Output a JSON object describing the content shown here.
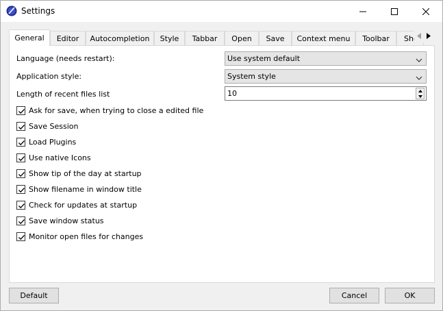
{
  "window": {
    "title": "Settings",
    "app_icon": "app-orb-icon",
    "controls": [
      "minimize-icon",
      "maximize-icon",
      "close-icon"
    ]
  },
  "tabs": [
    {
      "label": "General",
      "active": true
    },
    {
      "label": "Editor"
    },
    {
      "label": "Autocompletion"
    },
    {
      "label": "Style"
    },
    {
      "label": "Tabbar"
    },
    {
      "label": "Open"
    },
    {
      "label": "Save"
    },
    {
      "label": "Context menu"
    },
    {
      "label": "Toolbar"
    },
    {
      "label": "Sho"
    }
  ],
  "general": {
    "language_label": "Language (needs restart):",
    "language_value": "Use system default",
    "style_label": "Application style:",
    "style_value": "System style",
    "recent_label": "Length of recent files list",
    "recent_value": "10",
    "options": [
      {
        "label": "Ask for save, when trying to close a edited file",
        "checked": true
      },
      {
        "label": "Save Session",
        "checked": true
      },
      {
        "label": "Load Plugins",
        "checked": true
      },
      {
        "label": "Use native Icons",
        "checked": true
      },
      {
        "label": "Show tip of the day at startup",
        "checked": true
      },
      {
        "label": "Show filename in window title",
        "checked": true
      },
      {
        "label": "Check for updates at startup",
        "checked": true
      },
      {
        "label": "Save window status",
        "checked": true
      },
      {
        "label": "Monitor open files for changes",
        "checked": true
      }
    ]
  },
  "buttons": {
    "default": "Default",
    "cancel": "Cancel",
    "ok": "OK"
  },
  "colors": {
    "accent": "#2b3b9e",
    "panel": "#ffffff",
    "chrome": "#f0f0f0"
  }
}
